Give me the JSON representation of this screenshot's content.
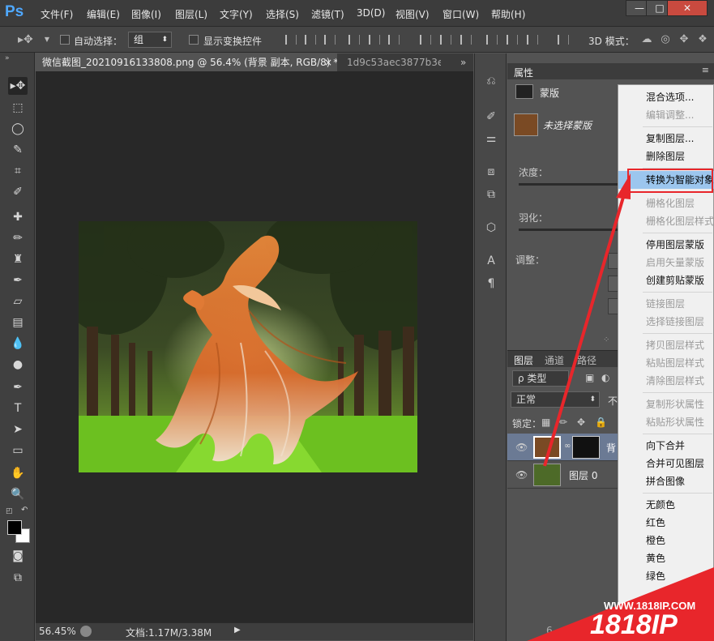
{
  "menubar": {
    "logo": "Ps",
    "items": [
      "文件(F)",
      "编辑(E)",
      "图像(I)",
      "图层(L)",
      "文字(Y)",
      "选择(S)",
      "滤镜(T)",
      "3D(D)",
      "视图(V)",
      "窗口(W)",
      "帮助(H)"
    ],
    "minimize": "—",
    "maximize": "□",
    "close": "✕"
  },
  "options": {
    "auto_select_label": "自动选择：",
    "auto_select_value": "组",
    "show_transform_label": "显示变换控件",
    "mode_3d_label": "3D 模式："
  },
  "document": {
    "tab_active": "微信截图_20210916133808.png @ 56.4% (背景 副本, RGB/8) *",
    "tab_close": "×",
    "tab_inactive": "1d9c53aec3877b3e8",
    "tab_more": "»",
    "zoom": "56.45%",
    "doc_info": "文档:1.17M/3.38M"
  },
  "properties": {
    "title": "属性",
    "mask_label": "蒙版",
    "no_mask_selected": "未选择蒙版",
    "density_label": "浓度：",
    "feather_label": "羽化：",
    "adjust_label": "调整："
  },
  "layers": {
    "tabs": [
      "图层",
      "通道",
      "路径"
    ],
    "kind_label": "ρ 类型",
    "blend_mode": "正常",
    "opacity_label": "不",
    "lock_label": "锁定：",
    "rows": [
      {
        "name": "背"
      },
      {
        "name": "图层 0"
      }
    ],
    "footer_text": "6"
  },
  "context_menu": {
    "items": [
      {
        "label": "混合选项...",
        "enabled": true
      },
      {
        "label": "编辑调整...",
        "enabled": false
      },
      {
        "label": "复制图层...",
        "enabled": true
      },
      {
        "label": "删除图层",
        "enabled": true
      },
      {
        "label": "转换为智能对象",
        "enabled": true,
        "highlighted": true
      },
      {
        "label": "栅格化图层",
        "enabled": false
      },
      {
        "label": "栅格化图层样式",
        "enabled": false
      },
      {
        "label": "停用图层蒙版",
        "enabled": true
      },
      {
        "label": "启用矢量蒙版",
        "enabled": false
      },
      {
        "label": "创建剪贴蒙版",
        "enabled": true
      },
      {
        "label": "链接图层",
        "enabled": false
      },
      {
        "label": "选择链接图层",
        "enabled": false
      },
      {
        "label": "拷贝图层样式",
        "enabled": false
      },
      {
        "label": "粘贴图层样式",
        "enabled": false
      },
      {
        "label": "清除图层样式",
        "enabled": false
      },
      {
        "label": "复制形状属性",
        "enabled": false
      },
      {
        "label": "粘贴形状属性",
        "enabled": false
      },
      {
        "label": "向下合并",
        "enabled": true
      },
      {
        "label": "合并可见图层",
        "enabled": true
      },
      {
        "label": "拼合图像",
        "enabled": true
      },
      {
        "label": "无颜色",
        "enabled": true
      },
      {
        "label": "红色",
        "enabled": true
      },
      {
        "label": "橙色",
        "enabled": true
      },
      {
        "label": "黄色",
        "enabled": true
      },
      {
        "label": "绿色",
        "enabled": true
      }
    ]
  },
  "watermark": {
    "url": "WWW.1818IP.COM",
    "logo": "1818IP"
  },
  "colors": {
    "ps_blue": "#4fa8ff",
    "annotation_red": "#e8262b",
    "menu_highlight": "#9cc6ee"
  }
}
